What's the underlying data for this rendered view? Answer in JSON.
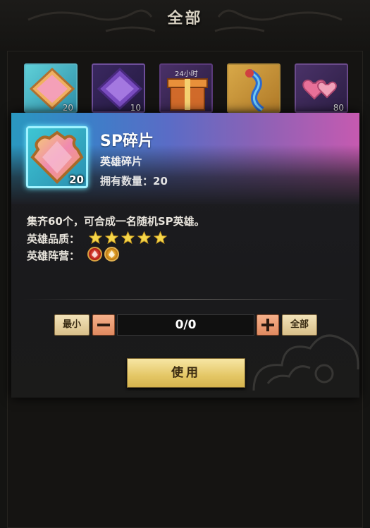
{
  "header": {
    "title": "全部"
  },
  "inventory": [
    {
      "icon": "hero-fragment-icon",
      "count": "20",
      "border": "#4a9fb0",
      "bg": "#3aa8b8"
    },
    {
      "icon": "purple-fragment-icon",
      "count": "10",
      "border": "#6e4e9a",
      "bg": "#2c1e48"
    },
    {
      "icon": "gift-box-icon",
      "badge": "24小时",
      "count": "",
      "border": "#5a3a7a",
      "bg": "#3a2850"
    },
    {
      "icon": "blue-dragon-icon",
      "count": "",
      "border": "#b08a3a",
      "bg": "#c89a3e"
    },
    {
      "icon": "hearts-icon",
      "count": "80",
      "border": "#6a4a8a",
      "bg": "#3c2a58"
    }
  ],
  "detail": {
    "icon": "sp-fragment-icon",
    "count": "20",
    "name": "SP碎片",
    "type": "英雄碎片",
    "owned_label": "拥有数量：",
    "owned_value": "20",
    "description": "集齐60个，可合成一名随机SP英雄。",
    "quality_label": "英雄品质：",
    "quality_stars": 5,
    "faction_label": "英雄阵营：",
    "factions": [
      "red-faction-icon",
      "gold-faction-icon"
    ]
  },
  "quantity": {
    "min_label": "最小",
    "value": "0/0",
    "max_label": "全部"
  },
  "actions": {
    "use_label": "使用"
  },
  "colors": {
    "star": "#f5d64a",
    "accent_gold": "#e4c766"
  }
}
